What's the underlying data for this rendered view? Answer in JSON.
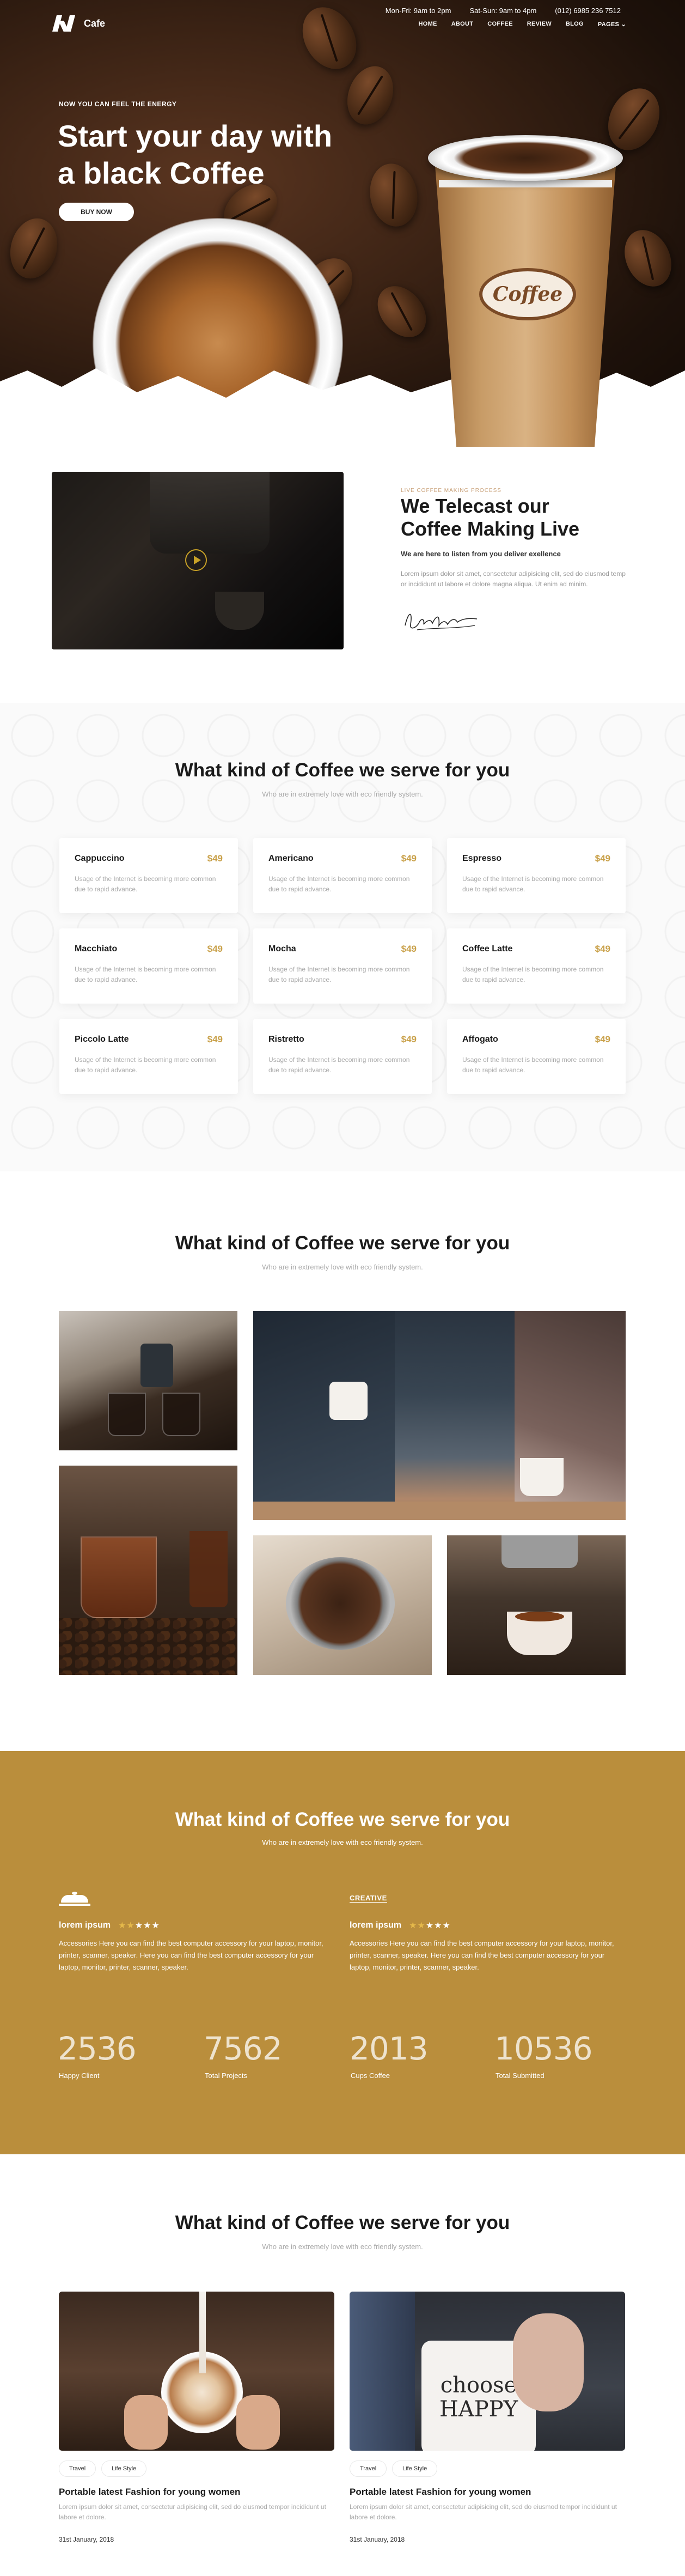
{
  "header": {
    "logo_text": "Cafe",
    "hours_weekday": "Mon-Fri: 9am to 2pm",
    "hours_weekend": "Sat-Sun: 9am to 4pm",
    "phone": "(012) 6985 236 7512",
    "nav": [
      "HOME",
      "ABOUT",
      "COFFEE",
      "REVIEW",
      "BLOG",
      "PAGES"
    ]
  },
  "hero": {
    "eyebrow": "NOW YOU CAN FEEL THE ENERGY",
    "title_line1": "Start your day with",
    "title_line2": "a black Coffee",
    "button": "BUY NOW",
    "cup_label": "Coffee"
  },
  "live": {
    "eyebrow": "LIVE COFFEE MAKING PROCESS",
    "title_line1": "We Telecast our",
    "title_line2": "Coffee Making Live",
    "subtitle": "We are here to listen from you deliver exellence",
    "desc": "Lorem ipsum dolor sit amet, consectetur adipisicing elit, sed do eiusmod temp or incididunt ut labore et dolore magna aliqua. Ut enim ad minim."
  },
  "menu": {
    "title": "What kind of Coffee we serve for you",
    "subtitle": "Who are in extremely love with eco friendly system.",
    "items": [
      {
        "name": "Cappuccino",
        "price": "$49",
        "desc": "Usage of the Internet is becoming more common due to rapid advance."
      },
      {
        "name": "Americano",
        "price": "$49",
        "desc": "Usage of the Internet is becoming more common due to rapid advance."
      },
      {
        "name": "Espresso",
        "price": "$49",
        "desc": "Usage of the Internet is becoming more common due to rapid advance."
      },
      {
        "name": "Macchiato",
        "price": "$49",
        "desc": "Usage of the Internet is becoming more common due to rapid advance."
      },
      {
        "name": "Mocha",
        "price": "$49",
        "desc": "Usage of the Internet is becoming more common due to rapid advance."
      },
      {
        "name": "Coffee Latte",
        "price": "$49",
        "desc": "Usage of the Internet is becoming more common due to rapid advance."
      },
      {
        "name": "Piccolo Latte",
        "price": "$49",
        "desc": "Usage of the Internet is becoming more common due to rapid advance."
      },
      {
        "name": "Ristretto",
        "price": "$49",
        "desc": "Usage of the Internet is becoming more common due to rapid advance."
      },
      {
        "name": "Affogato",
        "price": "$49",
        "desc": "Usage of the Internet is becoming more common due to rapid advance."
      }
    ]
  },
  "gallery": {
    "title": "What kind of Coffee we serve for you",
    "subtitle": "Who are in extremely love with eco friendly system."
  },
  "testimonials": {
    "title": "What kind of Coffee we serve for you",
    "subtitle": "Who are in extremely love with eco friendly system.",
    "items": [
      {
        "name": "lorem ipsum",
        "rating": 5,
        "logo": "cafe-logo",
        "text": "Accessories Here you can find the best computer accessory for your laptop, monitor, printer, scanner, speaker. Here you can find the best computer accessory for your laptop, monitor, printer, scanner, speaker."
      },
      {
        "name": "lorem ipsum",
        "rating": 5,
        "logo_text": "CREATIVE",
        "text": "Accessories Here you can find the best computer accessory for your laptop, monitor, printer, scanner, speaker. Here you can find the best computer accessory for your laptop, monitor, printer, scanner, speaker."
      }
    ],
    "stats": [
      {
        "value": "2536",
        "label": "Happy Client"
      },
      {
        "value": "7562",
        "label": "Total Projects"
      },
      {
        "value": "2013",
        "label": "Cups Coffee"
      },
      {
        "value": "10536",
        "label": "Total Submitted"
      }
    ]
  },
  "blog": {
    "title": "What kind of Coffee we serve for you",
    "subtitle": "Who are in extremely love with eco friendly system.",
    "posts": [
      {
        "tags": [
          "Travel",
          "Life Style"
        ],
        "title": "Portable latest Fashion for young women",
        "desc": "Lorem ipsum dolor sit amet, consectetur adipisicing elit, sed do eiusmod tempor incididunt ut labore et dolore.",
        "date": "31st January, 2018"
      },
      {
        "tags": [
          "Travel",
          "Life Style"
        ],
        "title": "Portable latest Fashion for young women",
        "desc": "Lorem ipsum dolor sit amet, consectetur adipisicing elit, sed do eiusmod tempor incididunt ut labore et dolore.",
        "date": "31st January, 2018",
        "mug_text": "choose HAPPY"
      }
    ]
  },
  "colors": {
    "accent": "#ba8e3c",
    "price": "#c9a14a",
    "dark": "#1b1b1b"
  }
}
